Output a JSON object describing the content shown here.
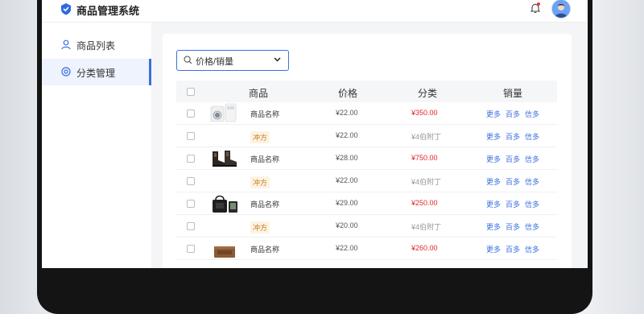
{
  "app": {
    "title": "商品管理系统"
  },
  "sidebar": {
    "items": [
      {
        "label": "商品列表",
        "icon": "user-icon"
      },
      {
        "label": "分类管理",
        "icon": "circle-target-icon",
        "active": true
      }
    ]
  },
  "filter": {
    "value": "价格/销量"
  },
  "table": {
    "headers": {
      "product": "商品",
      "price": "价格",
      "category": "分类",
      "sales": "销量"
    },
    "rows": [
      {
        "name": "商品名称",
        "price": "¥22.00",
        "category": "¥350.00",
        "cat_style": "red",
        "thumb": "washing-machine"
      },
      {
        "name": "冲方",
        "tag": true,
        "price": "¥22.00",
        "category": "¥4伯附丁",
        "cat_style": "gray"
      },
      {
        "name": "商品名称",
        "price": "¥28.00",
        "category": "¥750.00",
        "cat_style": "red",
        "thumb": "boots"
      },
      {
        "name": "冲方",
        "tag": true,
        "price": "¥22.00",
        "category": "¥4伯附丁",
        "cat_style": "gray"
      },
      {
        "name": "商品名称",
        "price": "¥29.00",
        "category": "¥250.00",
        "cat_style": "red",
        "thumb": "bag"
      },
      {
        "name": "冲方",
        "tag": true,
        "price": "¥20.00",
        "category": "¥4伯附丁",
        "cat_style": "gray"
      },
      {
        "name": "商品名称",
        "price": "¥22.00",
        "category": "¥260.00",
        "cat_style": "red",
        "thumb": "box"
      }
    ],
    "actions": [
      "更多",
      "百多",
      "信多"
    ]
  },
  "colors": {
    "accent": "#3b6fe0",
    "danger": "#e0282e",
    "tag": "#c77a1a"
  }
}
